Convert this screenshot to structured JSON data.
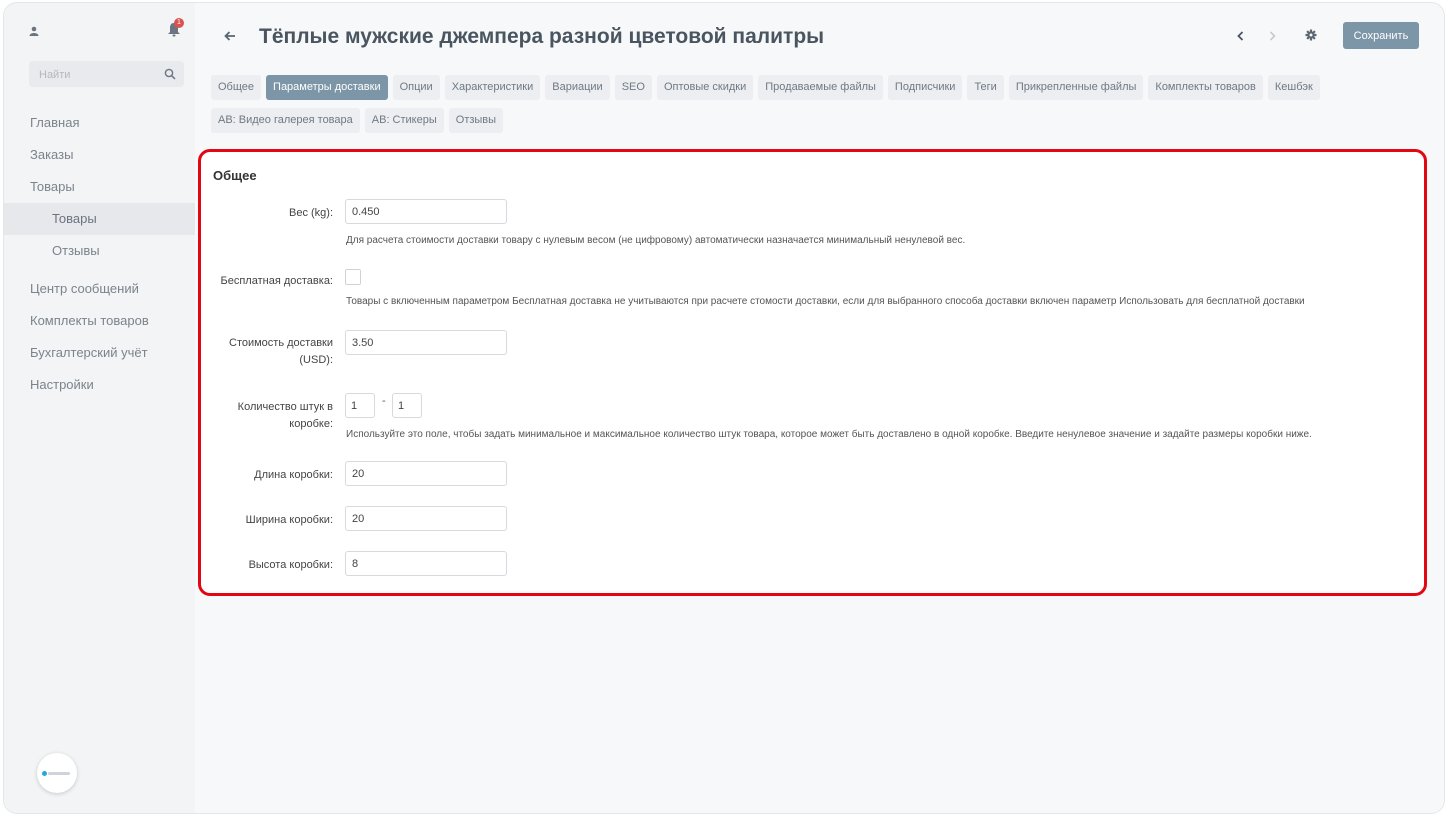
{
  "sidebar": {
    "search_placeholder": "Найти",
    "notification_count": "1",
    "items": [
      {
        "label": "Главная"
      },
      {
        "label": "Заказы"
      },
      {
        "label": "Товары"
      },
      {
        "label": "Товары"
      },
      {
        "label": "Отзывы"
      },
      {
        "label": "Центр сообщений"
      },
      {
        "label": "Комплекты товаров"
      },
      {
        "label": "Бухгалтерский учёт"
      },
      {
        "label": "Настройки"
      }
    ]
  },
  "header": {
    "title": "Тёплые мужские джемпера разной цветовой палитры",
    "save_label": "Сохранить"
  },
  "tabs": [
    {
      "label": "Общее"
    },
    {
      "label": "Параметры доставки"
    },
    {
      "label": "Опции"
    },
    {
      "label": "Характеристики"
    },
    {
      "label": "Вариации"
    },
    {
      "label": "SEO"
    },
    {
      "label": "Оптовые скидки"
    },
    {
      "label": "Продаваемые файлы"
    },
    {
      "label": "Подписчики"
    },
    {
      "label": "Теги"
    },
    {
      "label": "Прикрепленные файлы"
    },
    {
      "label": "Комплекты товаров"
    },
    {
      "label": "Кешбэк"
    },
    {
      "label": "AB: Видео галерея товара"
    },
    {
      "label": "AB: Стикеры"
    },
    {
      "label": "Отзывы"
    }
  ],
  "form": {
    "section_title": "Общее",
    "weight": {
      "label": "Вес (kg):",
      "value": "0.450",
      "hint": "Для расчета стоимости доставки товару с нулевым весом (не цифровому) автоматически назначается минимальный ненулевой вес."
    },
    "free_shipping": {
      "label": "Бесплатная доставка:",
      "hint": "Товары с включенным параметром Бесплатная доставка не учитываются при расчете стомости доставки, если для выбранного способа доставки включен параметр Использовать для бесплатной доставки"
    },
    "shipping_cost": {
      "label_line1": "Стоимость доставки",
      "label_line2": "(USD):",
      "value": "3.50"
    },
    "box_quantity": {
      "label_line1": "Количество штук в",
      "label_line2": "коробке:",
      "min": "1",
      "separator": "-",
      "max": "1",
      "hint": "Используйте это поле, чтобы задать минимальное и максимальное количество штук товара, которое может быть доставлено в одной коробке. Введите ненулевое значение и задайте размеры коробки ниже."
    },
    "box_length": {
      "label": "Длина коробки:",
      "value": "20"
    },
    "box_width": {
      "label": "Ширина коробки:",
      "value": "20"
    },
    "box_height": {
      "label": "Высота коробки:",
      "value": "8"
    }
  }
}
